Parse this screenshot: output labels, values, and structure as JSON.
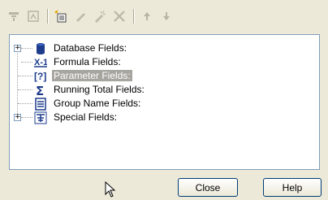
{
  "toolbar": {
    "items": [
      {
        "name": "browse-icon",
        "enabled": false
      },
      {
        "name": "find-icon",
        "enabled": false
      },
      {
        "name": "new-icon",
        "enabled": true
      },
      {
        "name": "edit-icon",
        "enabled": false
      },
      {
        "name": "rename-icon",
        "enabled": false
      },
      {
        "name": "delete-icon",
        "enabled": false
      },
      {
        "name": "move-up-icon",
        "enabled": false
      },
      {
        "name": "move-down-icon",
        "enabled": false
      }
    ]
  },
  "tree": {
    "items": [
      {
        "label": "Database Fields:",
        "icon": "database-icon",
        "expandable": true,
        "selected": false
      },
      {
        "label": "Formula Fields:",
        "icon": "formula-icon",
        "expandable": false,
        "selected": false
      },
      {
        "label": "Parameter Fields:",
        "icon": "parameter-icon",
        "expandable": false,
        "selected": true
      },
      {
        "label": "Running Total Fields:",
        "icon": "sigma-icon",
        "expandable": false,
        "selected": false
      },
      {
        "label": "Group Name Fields:",
        "icon": "group-icon",
        "expandable": false,
        "selected": false
      },
      {
        "label": "Special Fields:",
        "icon": "special-icon",
        "expandable": true,
        "selected": false
      }
    ],
    "expander_glyph": "+"
  },
  "buttons": {
    "close_label": "Close",
    "help_label": "Help"
  },
  "colors": {
    "selection": "#a7a59f",
    "window": "#ece9d8",
    "panel_border": "#7f9db9"
  }
}
